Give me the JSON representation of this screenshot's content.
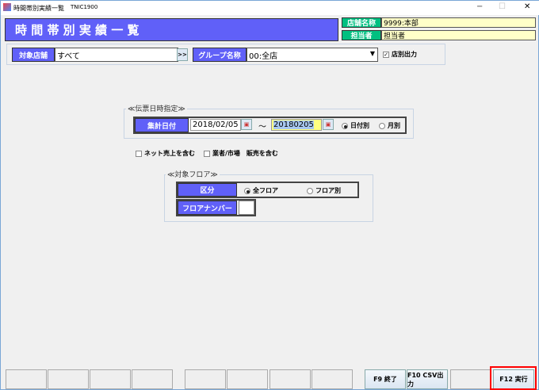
{
  "window": {
    "title": "時間帯別実績一覧",
    "code": "TNIC1900",
    "minimize": "−",
    "maximize": "☐",
    "close": "✕"
  },
  "header": {
    "title": "時 間 帯 別 実 績 一 覧",
    "store_name_label": "店舗名称",
    "store_name_value": "9999:本部",
    "staff_label": "担当者",
    "staff_value": "担当者"
  },
  "filters": {
    "target_store_label": "対象店舗",
    "target_store_value": "すべて",
    "browse_label": ">>",
    "group_label": "グループ名称",
    "group_value": "00:全店",
    "store_output_label": "店別出力",
    "store_output_checked": true
  },
  "date_section": {
    "legend": "≪伝票日時指定≫",
    "label": "集計日付",
    "from": "2018/02/05",
    "separator": "～",
    "to": "20180205",
    "by_day": "日付別",
    "by_month": "月別",
    "selected": "日付別"
  },
  "options": {
    "net_sales": "ネット売上を含む",
    "vendor_market": "業者/市場　販売を含む"
  },
  "floor_section": {
    "legend": "≪対象フロア≫",
    "category_label": "区分",
    "all_floors": "全フロア",
    "by_floor": "フロア別",
    "selected": "全フロア",
    "floor_number_label": "フロアナンバー",
    "floor_number_value": ""
  },
  "function_keys": [
    {
      "label": ""
    },
    {
      "label": ""
    },
    {
      "label": ""
    },
    {
      "label": ""
    },
    {
      "label": ""
    },
    {
      "label": ""
    },
    {
      "label": ""
    },
    {
      "label": ""
    },
    {
      "label": "F9 終了"
    },
    {
      "label": "F10 CSV出力"
    },
    {
      "label": ""
    },
    {
      "label": "F12 実行"
    }
  ],
  "colors": {
    "label_bg": "#6060f8",
    "green_label": "#00c080",
    "highlight": "#ff0000"
  }
}
